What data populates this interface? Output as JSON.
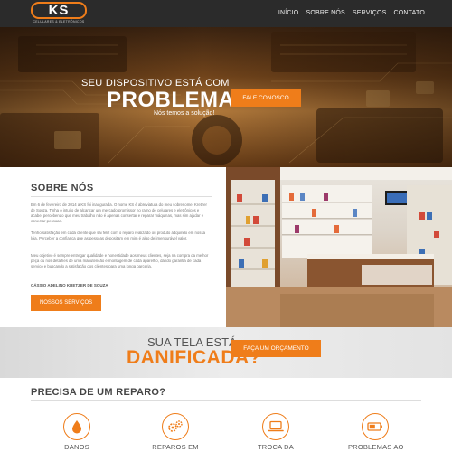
{
  "brand": {
    "logo_text": "KS",
    "logo_sub": "CELULARES & ELETRÔNICOS",
    "accent": "#ef7d1a",
    "header_bg": "#2b2b2b"
  },
  "nav": {
    "items": [
      {
        "label": "INÍCIO"
      },
      {
        "label": "SOBRE NÓS"
      },
      {
        "label": "SERVIÇOS"
      },
      {
        "label": "CONTATO"
      }
    ]
  },
  "hero": {
    "title": "SEU DISPOSITIVO ESTÁ COM",
    "big": "PROBLEMAS?",
    "sub": "Nós temos a solução!",
    "button": "FALE CONOSCO"
  },
  "about": {
    "title": "SOBRE NÓS",
    "paragraphs": [
      "Em 6 de fevereiro de 2014 a KS foi inaugurada. O nome KS é abreviatura do meu sobrenome, Kretzer de Souza. Tinha o intuito de alcançar um mercado promissor no ramo de celulares e eletrônicos e acabei percebendo que meu trabalho não é apenas consertar e reparar máquinas, mas sim ajudar e conectar pessoas.",
      "Tenho satisfação em cada cliente que sai feliz com o reparo realizado ou produto adquirido em nossa loja. Perceber a confiança que as pessoas depositam em mim é algo de imensurável valor.",
      "Meu objetivo é sempre entregar qualidade e honestidade aos meus clientes, seja na compra da melhor peça ou nos detalhes de uma manutenção e montagem de cada aparelho, dando garantia de cada serviço e buscando a satisfação dos clientes para uma longa parceria."
    ],
    "signature": "CÁSSIO ADELINO KRETZER DE SOUZA",
    "button": "NOSSOS SERVIÇOS"
  },
  "banner": {
    "small": "SUA TELA ESTÁ",
    "big": "DANIFICADA?",
    "button": "FAÇA UM ORÇAMENTO"
  },
  "services": {
    "title": "PRECISA DE UM REPARO?",
    "items": [
      {
        "label": "DANOS",
        "icon": "water-drop-icon"
      },
      {
        "label": "REPAROS EM",
        "icon": "gears-icon"
      },
      {
        "label": "TROCA DA",
        "icon": "laptop-icon"
      },
      {
        "label": "PROBLEMAS AO",
        "icon": "battery-icon"
      }
    ]
  }
}
